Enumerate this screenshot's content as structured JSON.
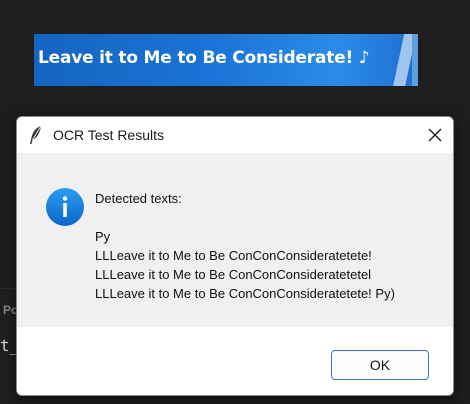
{
  "background": {
    "banner_text": "Leave it to Me to Be Considerate! ♪",
    "panel_label": "Po",
    "code_fragment": "t_"
  },
  "dialog": {
    "title": "OCR Test Results",
    "icon": "info-icon",
    "message_header": "Detected texts:",
    "message_lines": [
      "Py",
      "LLLeave it to Me to Be ConConConsideratetete!",
      "LLLeave it to Me to Be ConConConsideratetetel",
      "LLLeave it to Me to Be ConConConsideratetete! Py)"
    ],
    "ok_label": "OK"
  },
  "colors": {
    "accent": "#1a73d6",
    "dialog_body": "#f0f0f0",
    "button_border": "#3b76c6"
  }
}
